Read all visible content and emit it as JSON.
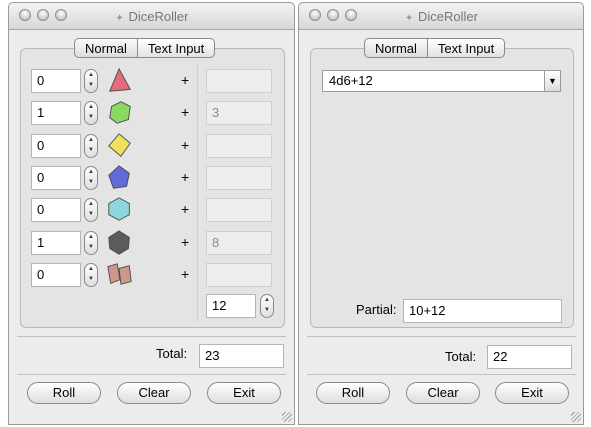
{
  "app": {
    "title": "DiceRoller"
  },
  "tabs": [
    "Normal",
    "Text Input"
  ],
  "left": {
    "rows": [
      {
        "count": "0",
        "die": "d4",
        "color": "#e8566a",
        "mod": ""
      },
      {
        "count": "1",
        "die": "d6",
        "color": "#7ad84c",
        "mod": "3"
      },
      {
        "count": "0",
        "die": "d8",
        "color": "#f2e04a",
        "mod": ""
      },
      {
        "count": "0",
        "die": "d10",
        "color": "#4a57d8",
        "mod": ""
      },
      {
        "count": "0",
        "die": "d12",
        "color": "#7fd4dc",
        "mod": ""
      },
      {
        "count": "1",
        "die": "d20",
        "color": "#444444",
        "mod": "8"
      },
      {
        "count": "0",
        "die": "d100",
        "color": "#c98b7a",
        "mod": ""
      }
    ],
    "plus": "+",
    "modifier_total": "12",
    "total_label": "Total:",
    "total_value": "23"
  },
  "right": {
    "expression": "4d6+12",
    "partial_label": "Partial:",
    "partial_value": "10+12",
    "total_label": "Total:",
    "total_value": "22"
  },
  "buttons": {
    "roll": "Roll",
    "clear": "Clear",
    "exit": "Exit"
  }
}
